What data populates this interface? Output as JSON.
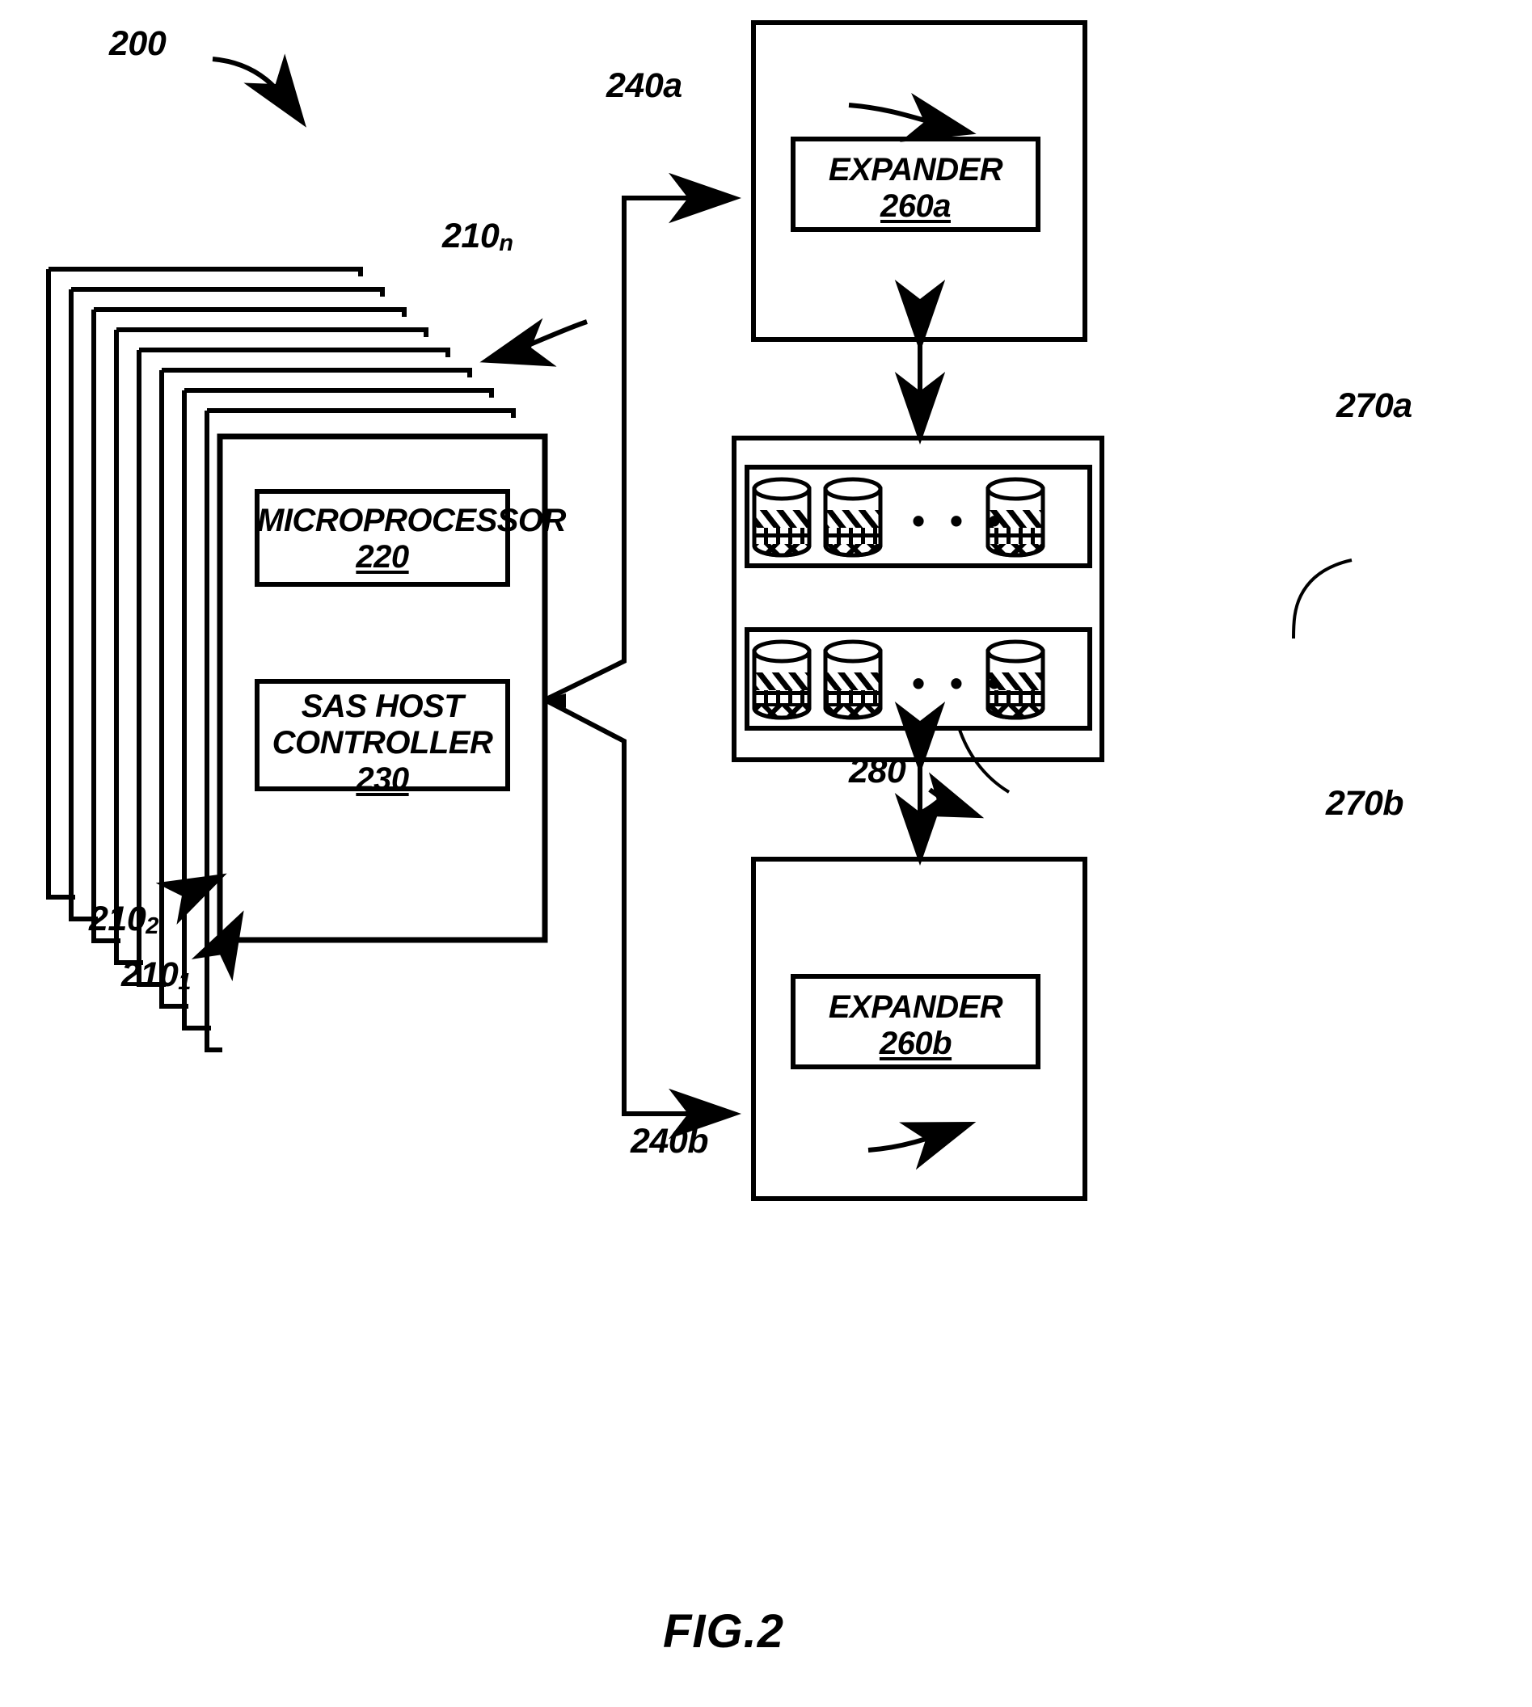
{
  "figure": {
    "caption": "FIG.2",
    "system_ref": "200"
  },
  "servers": {
    "stack_count": 9,
    "top_ref": "210",
    "top_ref_sub": "n",
    "second_ref": "210",
    "second_ref_sub": "2",
    "first_ref": "210",
    "first_ref_sub": "1",
    "microprocessor": {
      "title": "MICROPROCESSOR",
      "ref": "220"
    },
    "host_controller": {
      "title_line1": "SAS  HOST",
      "title_line2": "CONTROLLER",
      "ref": "230"
    }
  },
  "expanders": [
    {
      "enclosure_ref": "240a",
      "title": "EXPANDER",
      "ref": "260a"
    },
    {
      "enclosure_ref": "240b",
      "title": "EXPANDER",
      "ref": "260b"
    }
  ],
  "storage": {
    "enclosure_ref": "280",
    "arrays": [
      {
        "ref": "270a",
        "disk_count": 3,
        "ellipsis": "• • •"
      },
      {
        "ref": "270b",
        "disk_count": 3,
        "ellipsis": "• • •"
      }
    ]
  },
  "colors": {
    "ink": "#000000",
    "paper": "#ffffff"
  }
}
